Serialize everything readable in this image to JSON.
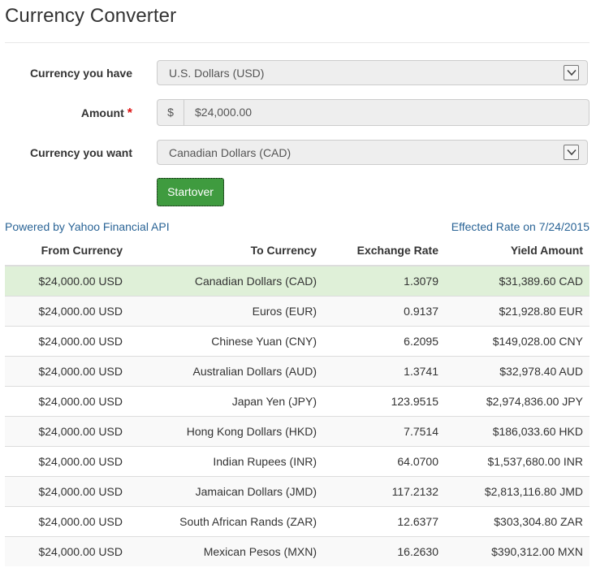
{
  "page": {
    "title": "Currency Converter"
  },
  "form": {
    "have_label": "Currency you have",
    "have_value": "U.S. Dollars (USD)",
    "amount_label": "Amount",
    "amount_required": "*",
    "amount_prefix": "$",
    "amount_value": "$24,000.00",
    "want_label": "Currency you want",
    "want_value": "Canadian Dollars (CAD)",
    "startover_label": "Startover"
  },
  "info": {
    "powered_by": "Powered by Yahoo Financial API",
    "effective_rate": "Effected Rate on 7/24/2015"
  },
  "table": {
    "headers": [
      "From Currency",
      "To Currency",
      "Exchange Rate",
      "Yield Amount"
    ],
    "rows": [
      {
        "from": "$24,000.00 USD",
        "to": "Canadian Dollars (CAD)",
        "rate": "1.3079",
        "yield": "$31,389.60 CAD"
      },
      {
        "from": "$24,000.00 USD",
        "to": "Euros (EUR)",
        "rate": "0.9137",
        "yield": "$21,928.80 EUR"
      },
      {
        "from": "$24,000.00 USD",
        "to": "Chinese Yuan (CNY)",
        "rate": "6.2095",
        "yield": "$149,028.00 CNY"
      },
      {
        "from": "$24,000.00 USD",
        "to": "Australian Dollars (AUD)",
        "rate": "1.3741",
        "yield": "$32,978.40 AUD"
      },
      {
        "from": "$24,000.00 USD",
        "to": "Japan Yen (JPY)",
        "rate": "123.9515",
        "yield": "$2,974,836.00 JPY"
      },
      {
        "from": "$24,000.00 USD",
        "to": "Hong Kong Dollars (HKD)",
        "rate": "7.7514",
        "yield": "$186,033.60 HKD"
      },
      {
        "from": "$24,000.00 USD",
        "to": "Indian Rupees (INR)",
        "rate": "64.0700",
        "yield": "$1,537,680.00 INR"
      },
      {
        "from": "$24,000.00 USD",
        "to": "Jamaican Dollars (JMD)",
        "rate": "117.2132",
        "yield": "$2,813,116.80 JMD"
      },
      {
        "from": "$24,000.00 USD",
        "to": "South African Rands (ZAR)",
        "rate": "12.6377",
        "yield": "$303,304.80 ZAR"
      },
      {
        "from": "$24,000.00 USD",
        "to": "Mexican Pesos (MXN)",
        "rate": "16.2630",
        "yield": "$390,312.00 MXN"
      }
    ]
  },
  "colors": {
    "highlight_row": "#dff0d8",
    "button": "#3f9b3f",
    "link": "#2a6496",
    "required": "#dd1111"
  },
  "icons": {
    "select_arrow": "chevron-down-icon"
  }
}
